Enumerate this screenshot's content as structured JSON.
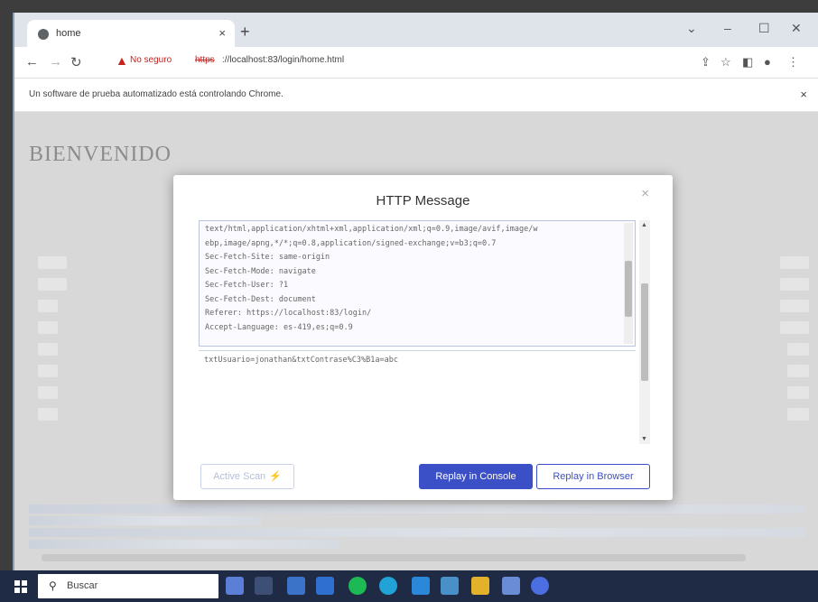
{
  "browser": {
    "tab_title": "home",
    "tab_close": "×",
    "new_tab": "+",
    "window_controls": [
      "⌄",
      "–",
      "☐",
      "✕"
    ],
    "security_label": "No seguro",
    "url_scheme": "https",
    "url_rest": "://localhost:83/login/home.html",
    "infobar_message": "Un software de prueba automatizado está controlando Chrome.",
    "infobar_close": "×"
  },
  "page": {
    "heading": "BIENVENIDO"
  },
  "modal": {
    "title": "HTTP Message",
    "close": "×",
    "headers_text": "text/html,application/xhtml+xml,application/xml;q=0.9,image/avif,image/w\nebp,image/apng,*/*;q=0.8,application/signed-exchange;v=b3;q=0.7\nSec-Fetch-Site: same-origin\nSec-Fetch-Mode: navigate\nSec-Fetch-User: ?1\nSec-Fetch-Dest: document\nReferer: https://localhost:83/login/\nAccept-Language: es-419,es;q=0.9",
    "body_text": "txtUsuario=jonathan&txtContrase%C3%B1a=abc",
    "active_scan_label": "Active Scan",
    "replay_console_label": "Replay in Console",
    "replay_browser_label": "Replay in Browser"
  },
  "taskbar": {
    "search_placeholder": "Buscar"
  },
  "colors": {
    "accent": "#3b4fc7",
    "warning": "#c5221f",
    "taskbar": "#1f2a44"
  }
}
